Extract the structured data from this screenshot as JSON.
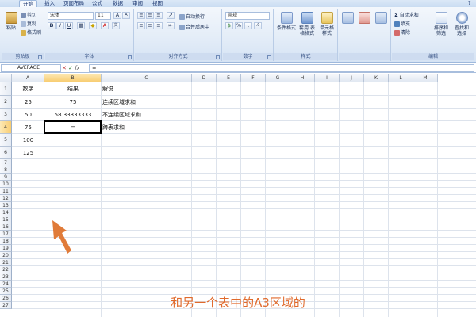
{
  "ribbon_tabs": [
    "开始",
    "插入",
    "页面布局",
    "公式",
    "数据",
    "审阅",
    "视图"
  ],
  "clipboard": {
    "paste": "粘贴",
    "cut": "剪切",
    "copy": "复制",
    "format_painter": "格式刷",
    "label": "剪贴板"
  },
  "font": {
    "name": "宋体",
    "size": "11",
    "bold": "B",
    "italic": "I",
    "underline": "U",
    "grow": "A",
    "shrink": "A",
    "label": "字体"
  },
  "alignment": {
    "wrap": "自动换行",
    "merge": "合并后居中",
    "label": "对齐方式"
  },
  "number": {
    "format": "常规",
    "percent": "%",
    "comma": ",",
    "label": "数字"
  },
  "styles": {
    "conditional": "条件格式",
    "table": "套用 表格格式",
    "cell": "单元格 样式",
    "label": "样式"
  },
  "cells": {
    "A1": "数字",
    "B1": "结果",
    "C1": "解说",
    "A2": "25",
    "B2": "75",
    "C2": "连续区域求和",
    "A3": "50",
    "B3": "58.33333333",
    "C3": "不连续区域求和",
    "A4": "75",
    "B4": "= ",
    "C4": "跨表求和",
    "A5": "100",
    "A6": "125"
  },
  "editing": {
    "autosum": "自动求和",
    "fill": "填充",
    "clear": "清除",
    "sort": "排序和 筛选",
    "find": "查找和 选择",
    "label": "编辑"
  },
  "formula_bar": {
    "name_box": "AVERAGE",
    "fx_cancel": "✕",
    "fx_enter": "✓",
    "fx": "fx",
    "formula": "="
  },
  "columns": [
    "A",
    "B",
    "C",
    "D",
    "E",
    "F",
    "G",
    "H",
    "I",
    "J",
    "K",
    "L",
    "M"
  ],
  "rows": [
    "1",
    "2",
    "3",
    "4",
    "5",
    "6",
    "7",
    "8",
    "9",
    "10",
    "11",
    "12",
    "13",
    "14",
    "15",
    "16",
    "17",
    "18",
    "19",
    "20",
    "21",
    "22",
    "23",
    "24",
    "25",
    "26",
    "27"
  ],
  "caption": "和另一个表中的A3区域的",
  "colors": {
    "accent": "#e07b39",
    "caption": "#e06a2c"
  }
}
